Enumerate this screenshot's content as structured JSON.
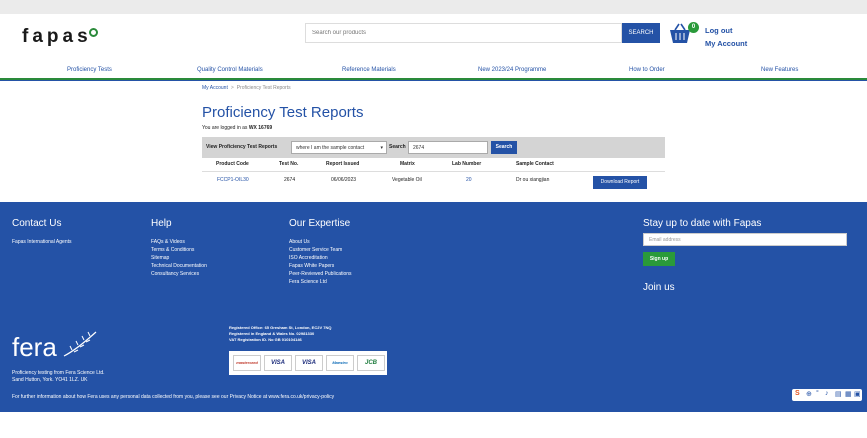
{
  "brand": {
    "logo_text": "fapas",
    "accent": "#2452a6",
    "green": "#2a8a3a"
  },
  "header": {
    "search_placeholder": "Search our products",
    "search_button": "SEARCH",
    "cart_count": "0",
    "logout": "Log out",
    "my_account": "My Account"
  },
  "nav": {
    "items": [
      "Proficiency Tests",
      "Quality Control Materials",
      "Reference Materials",
      "New 2023/24 Programme",
      "How to Order",
      "New Features"
    ]
  },
  "breadcrumb": {
    "home": "My Account",
    "separator": ">",
    "current": "Proficiency Test Reports"
  },
  "main": {
    "title": "Proficiency Test Reports",
    "logged_in_prefix": "You are logged in as",
    "logged_in_user": "WX 16769"
  },
  "filter": {
    "label": "View Proficiency Test Reports",
    "select_value": "where I am the sample contact",
    "search_label": "Search",
    "search_value": "2674",
    "search_button": "Search"
  },
  "table": {
    "headers": [
      "Product Code",
      "Test No.",
      "Report Issued",
      "Matrix",
      "Lab Number",
      "Sample Contact"
    ],
    "rows": [
      {
        "product_code": "FCCP1-OIL30",
        "test_no": "2674",
        "report_issued": "06/06/2023",
        "matrix": "Vegetable Oil",
        "lab_number": "20",
        "sample_contact": "Dr ou xiangjian",
        "action": "Download Report"
      }
    ]
  },
  "footer": {
    "contact": {
      "heading": "Contact Us",
      "items": [
        "Fapas International Agents"
      ]
    },
    "help": {
      "heading": "Help",
      "items": [
        "FAQs & Videos",
        "Terms & Conditions",
        "Sitemap",
        "Technical Documentation",
        "Consultancy Services"
      ]
    },
    "expertise": {
      "heading": "Our Expertise",
      "items": [
        "About Us",
        "Customer Service Team",
        "ISO Accreditation",
        "Fapas White Papers",
        "Peer-Reviewed Publications",
        "Fera Science Ltd"
      ]
    },
    "newsletter": {
      "heading": "Stay up to date with Fapas",
      "email_placeholder": "Email address",
      "button": "Sign up",
      "join": "Join us"
    },
    "fera_logo_text": "fera",
    "caption_lines": [
      "Proficiency testing from Fera Science Ltd.",
      "Sand Hutton, York. YO41 1LZ. UK"
    ],
    "registration_lines": [
      "Registered Office: 65 Gresham St, London, EC2V 7NQ",
      "Registered in England & Wales No. 02981330",
      "VAT Registration ID. No GB 010104146"
    ],
    "cards": [
      "mastercard",
      "VISA",
      "VISA",
      "Maestro",
      "JCB"
    ],
    "privacy": "For further information about how Fera uses any personal data collected from you, please see our Privacy Notice at www.fera.co.uk/privacy-policy"
  }
}
